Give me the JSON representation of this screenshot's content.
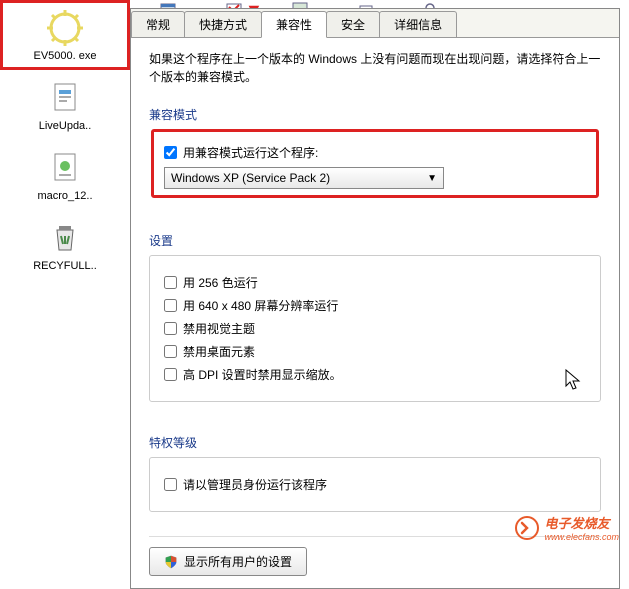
{
  "desktop": {
    "icons": [
      {
        "label": "EV5000. exe"
      },
      {
        "label": "LiveUpda.."
      },
      {
        "label": "macro_12.."
      },
      {
        "label": "RECYFULL.."
      }
    ]
  },
  "tabs": {
    "items": [
      {
        "label": "常规"
      },
      {
        "label": "快捷方式"
      },
      {
        "label": "兼容性"
      },
      {
        "label": "安全"
      },
      {
        "label": "详细信息"
      }
    ],
    "active_index": 2
  },
  "dialog": {
    "intro": "如果这个程序在上一个版本的 Windows 上没有问题而现在出现问题，请选择符合上一个版本的兼容模式。",
    "compat_mode": {
      "title": "兼容模式",
      "checkbox_label": "用兼容模式运行这个程序:",
      "checkbox_checked": true,
      "dropdown_value": "Windows XP (Service Pack 2)"
    },
    "settings": {
      "title": "设置",
      "options": [
        {
          "label": "用 256 色运行",
          "checked": false
        },
        {
          "label": "用 640 x 480 屏幕分辨率运行",
          "checked": false
        },
        {
          "label": "禁用视觉主题",
          "checked": false
        },
        {
          "label": "禁用桌面元素",
          "checked": false
        },
        {
          "label": "高 DPI 设置时禁用显示缩放。",
          "checked": false
        }
      ]
    },
    "privilege": {
      "title": "特权等级",
      "checkbox_label": "请以管理员身份运行该程序",
      "checked": false
    },
    "show_all_users_button": "显示所有用户的设置"
  },
  "watermark": {
    "text": "电子发烧友",
    "url": "www.elecfans.com"
  }
}
